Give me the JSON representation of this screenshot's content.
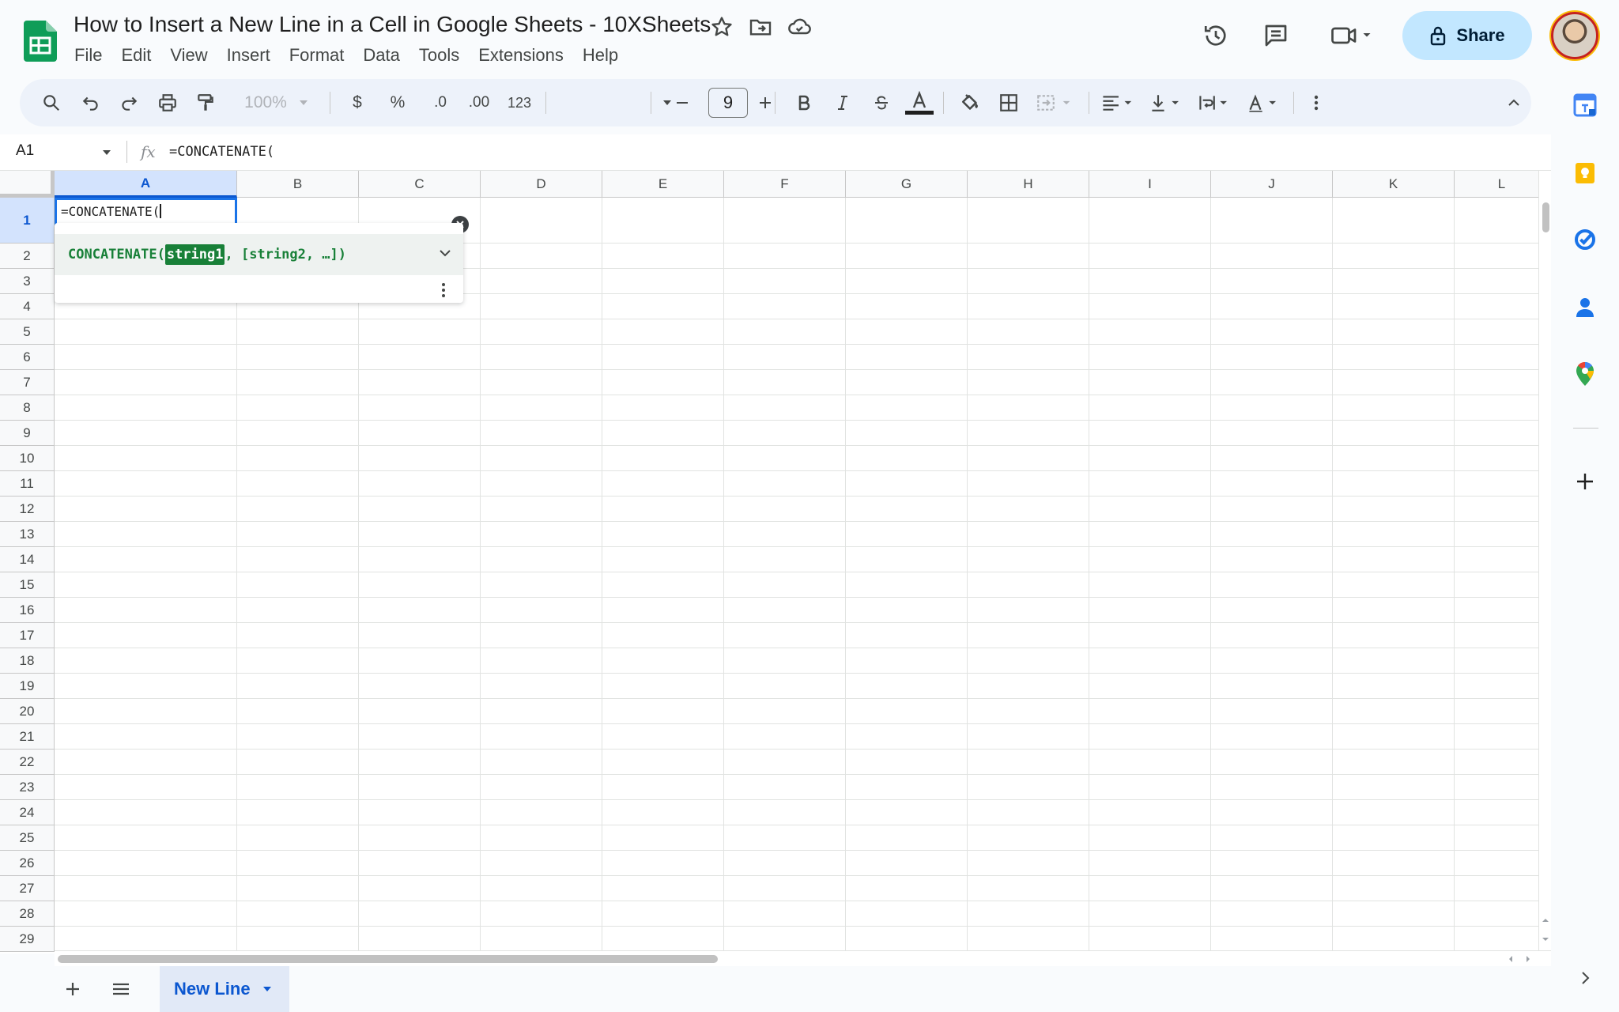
{
  "doc": {
    "title": "How to Insert a New Line in a Cell in Google Sheets - 10XSheets"
  },
  "menu": [
    "File",
    "Edit",
    "View",
    "Insert",
    "Format",
    "Data",
    "Tools",
    "Extensions",
    "Help"
  ],
  "header": {
    "share_label": "Share"
  },
  "toolbar": {
    "zoom": "100%",
    "currency": "$",
    "percent": "%",
    "decrease_decimal": ".0",
    "increase_decimal": ".00",
    "number_format": "123",
    "font_size": "9"
  },
  "formula_bar": {
    "cell_ref": "A1",
    "fx": "fx",
    "formula": "=CONCATENATE("
  },
  "grid": {
    "columns": [
      "A",
      "B",
      "C",
      "D",
      "E",
      "F",
      "G",
      "H",
      "I",
      "J",
      "K",
      "L"
    ],
    "rows": [
      "1",
      "2",
      "3",
      "4",
      "5",
      "6",
      "7",
      "8",
      "9",
      "10",
      "11",
      "12",
      "13",
      "14",
      "15",
      "16",
      "17",
      "18",
      "19",
      "20",
      "21",
      "22",
      "23",
      "24",
      "25",
      "26",
      "27",
      "28",
      "29"
    ],
    "selected_cell": "A1",
    "cell_a1_value": "=CONCATENATE("
  },
  "autocomplete": {
    "function_name": "CONCATENATE(",
    "active_param": "string1",
    "rest": ", [string2, …])"
  },
  "sheets": {
    "active_tab": "New Line"
  },
  "colors": {
    "accent": "#0b57d0",
    "selection": "#1a73e8",
    "share_bg": "#c2e7ff",
    "formula_green": "#188038",
    "sheets_green": "#0f9d58"
  }
}
